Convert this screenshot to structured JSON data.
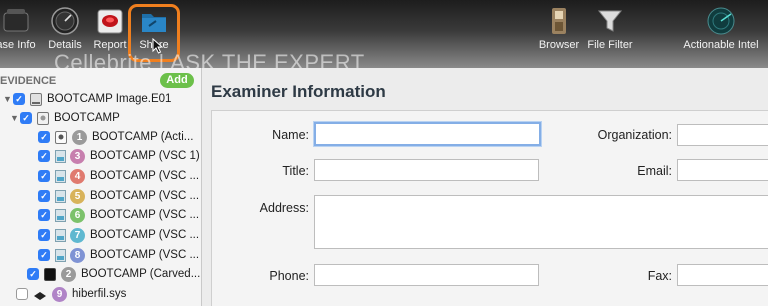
{
  "toolbar": {
    "buttons": [
      {
        "label": "ase Info",
        "icon": "case-info-icon"
      },
      {
        "label": "Details",
        "icon": "gauge-icon"
      },
      {
        "label": "Report",
        "icon": "report-icon"
      },
      {
        "label": "Share",
        "icon": "share-folder-icon"
      },
      {
        "label": "Browser",
        "icon": "browser-icon"
      },
      {
        "label": "File Filter",
        "icon": "funnel-icon"
      },
      {
        "label": "Actionable Intel",
        "icon": "radar-icon"
      }
    ],
    "watermark": "Cellebrite | ASK THE EXPERT",
    "highlight_color": "#f07f1e"
  },
  "sidebar": {
    "title": "EVIDENCE",
    "add_label": "Add",
    "items": [
      {
        "label": "BOOTCAMP Image.E01",
        "checked": true
      },
      {
        "label": "BOOTCAMP",
        "checked": true
      },
      {
        "num": "1",
        "label": "BOOTCAMP (Acti...",
        "checked": true,
        "color": "#9a9a9a"
      },
      {
        "num": "3",
        "label": "BOOTCAMP (VSC 1)",
        "checked": true,
        "color": "#c77fae"
      },
      {
        "num": "4",
        "label": "BOOTCAMP (VSC ...",
        "checked": true,
        "color": "#e07a6f"
      },
      {
        "num": "5",
        "label": "BOOTCAMP (VSC ...",
        "checked": true,
        "color": "#d8b35b"
      },
      {
        "num": "6",
        "label": "BOOTCAMP (VSC ...",
        "checked": true,
        "color": "#7cc26b"
      },
      {
        "num": "7",
        "label": "BOOTCAMP (VSC ...",
        "checked": true,
        "color": "#5fb8d0"
      },
      {
        "num": "8",
        "label": "BOOTCAMP (VSC ...",
        "checked": true,
        "color": "#7f93d4"
      },
      {
        "num": "2",
        "label": "BOOTCAMP (Carved...",
        "checked": true,
        "color": "#9a9a9a"
      },
      {
        "num": "9",
        "label": "hiberfil.sys",
        "checked": false,
        "color": "#b084c7"
      }
    ]
  },
  "main": {
    "title": "Examiner Information",
    "fields": {
      "name": {
        "label": "Name:",
        "value": ""
      },
      "organization": {
        "label": "Organization:",
        "value": ""
      },
      "title": {
        "label": "Title:",
        "value": ""
      },
      "email": {
        "label": "Email:",
        "value": ""
      },
      "address": {
        "label": "Address:",
        "value": ""
      },
      "phone": {
        "label": "Phone:",
        "value": ""
      },
      "fax": {
        "label": "Fax:",
        "value": ""
      }
    }
  }
}
